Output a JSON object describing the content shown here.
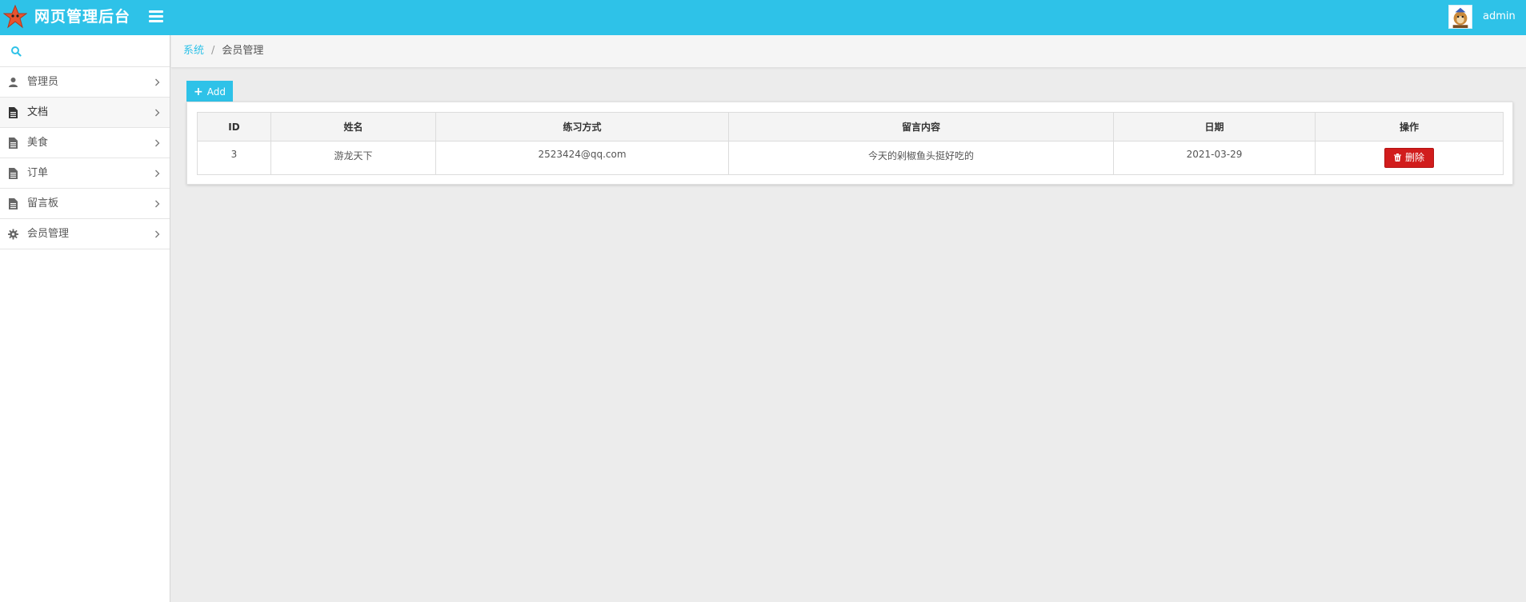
{
  "header": {
    "app_title": "网页管理后台",
    "username": "admin",
    "brand_color": "#2ec2e8"
  },
  "sidebar": {
    "search_placeholder": "",
    "items": [
      {
        "label": "管理员",
        "icon": "user-icon"
      },
      {
        "label": "文档",
        "icon": "document-icon",
        "active": true
      },
      {
        "label": "美食",
        "icon": "document-icon"
      },
      {
        "label": "订单",
        "icon": "document-icon"
      },
      {
        "label": "留言板",
        "icon": "document-icon"
      },
      {
        "label": "会员管理",
        "icon": "gear-icon"
      }
    ]
  },
  "breadcrumb": {
    "root": "系统",
    "separator": "/",
    "current": "会员管理"
  },
  "toolbar": {
    "add_label": "Add"
  },
  "table": {
    "columns": [
      "ID",
      "姓名",
      "练习方式",
      "留言内容",
      "日期",
      "操作"
    ],
    "rows": [
      {
        "id": "3",
        "name": "游龙天下",
        "contact": "2523424@qq.com",
        "message": "今天的剁椒鱼头挺好吃的",
        "date": "2021-03-29",
        "action": "删除"
      }
    ]
  },
  "colors": {
    "accent": "#2ec2e8",
    "danger": "#d11c1c"
  }
}
